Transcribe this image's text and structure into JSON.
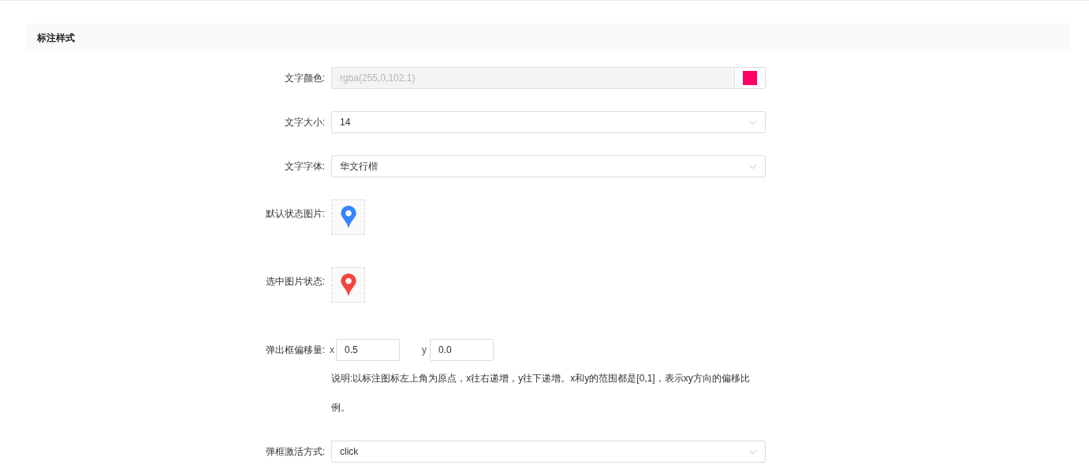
{
  "section": {
    "title": "标注样式"
  },
  "fields": [
    {
      "kind": "color",
      "label": "文字颜色:",
      "value": "rgba(255,0,102,1)",
      "color": "#ff0066",
      "disabled": true
    },
    {
      "kind": "select",
      "label": "文字大小:",
      "value": "14"
    },
    {
      "kind": "select",
      "label": "文字字体:",
      "value": "华文行楷"
    },
    {
      "kind": "image",
      "label": "默认状态图片:",
      "color": "#3385ff"
    },
    {
      "kind": "image",
      "label": "选中图片状态:",
      "color": "#f5443a"
    },
    {
      "kind": "offset",
      "label": "弹出框偏移量:",
      "x_label": "x",
      "x_value": "0.5",
      "y_label": "y",
      "y_value": "0.0",
      "note": "说明:以标注图标左上角为原点，x往右递增，y往下递增。x和y的范围都是[0,1]，表示xy方向的偏移比例。"
    },
    {
      "kind": "select",
      "label": "弹框激活方式:",
      "value": "click"
    }
  ]
}
